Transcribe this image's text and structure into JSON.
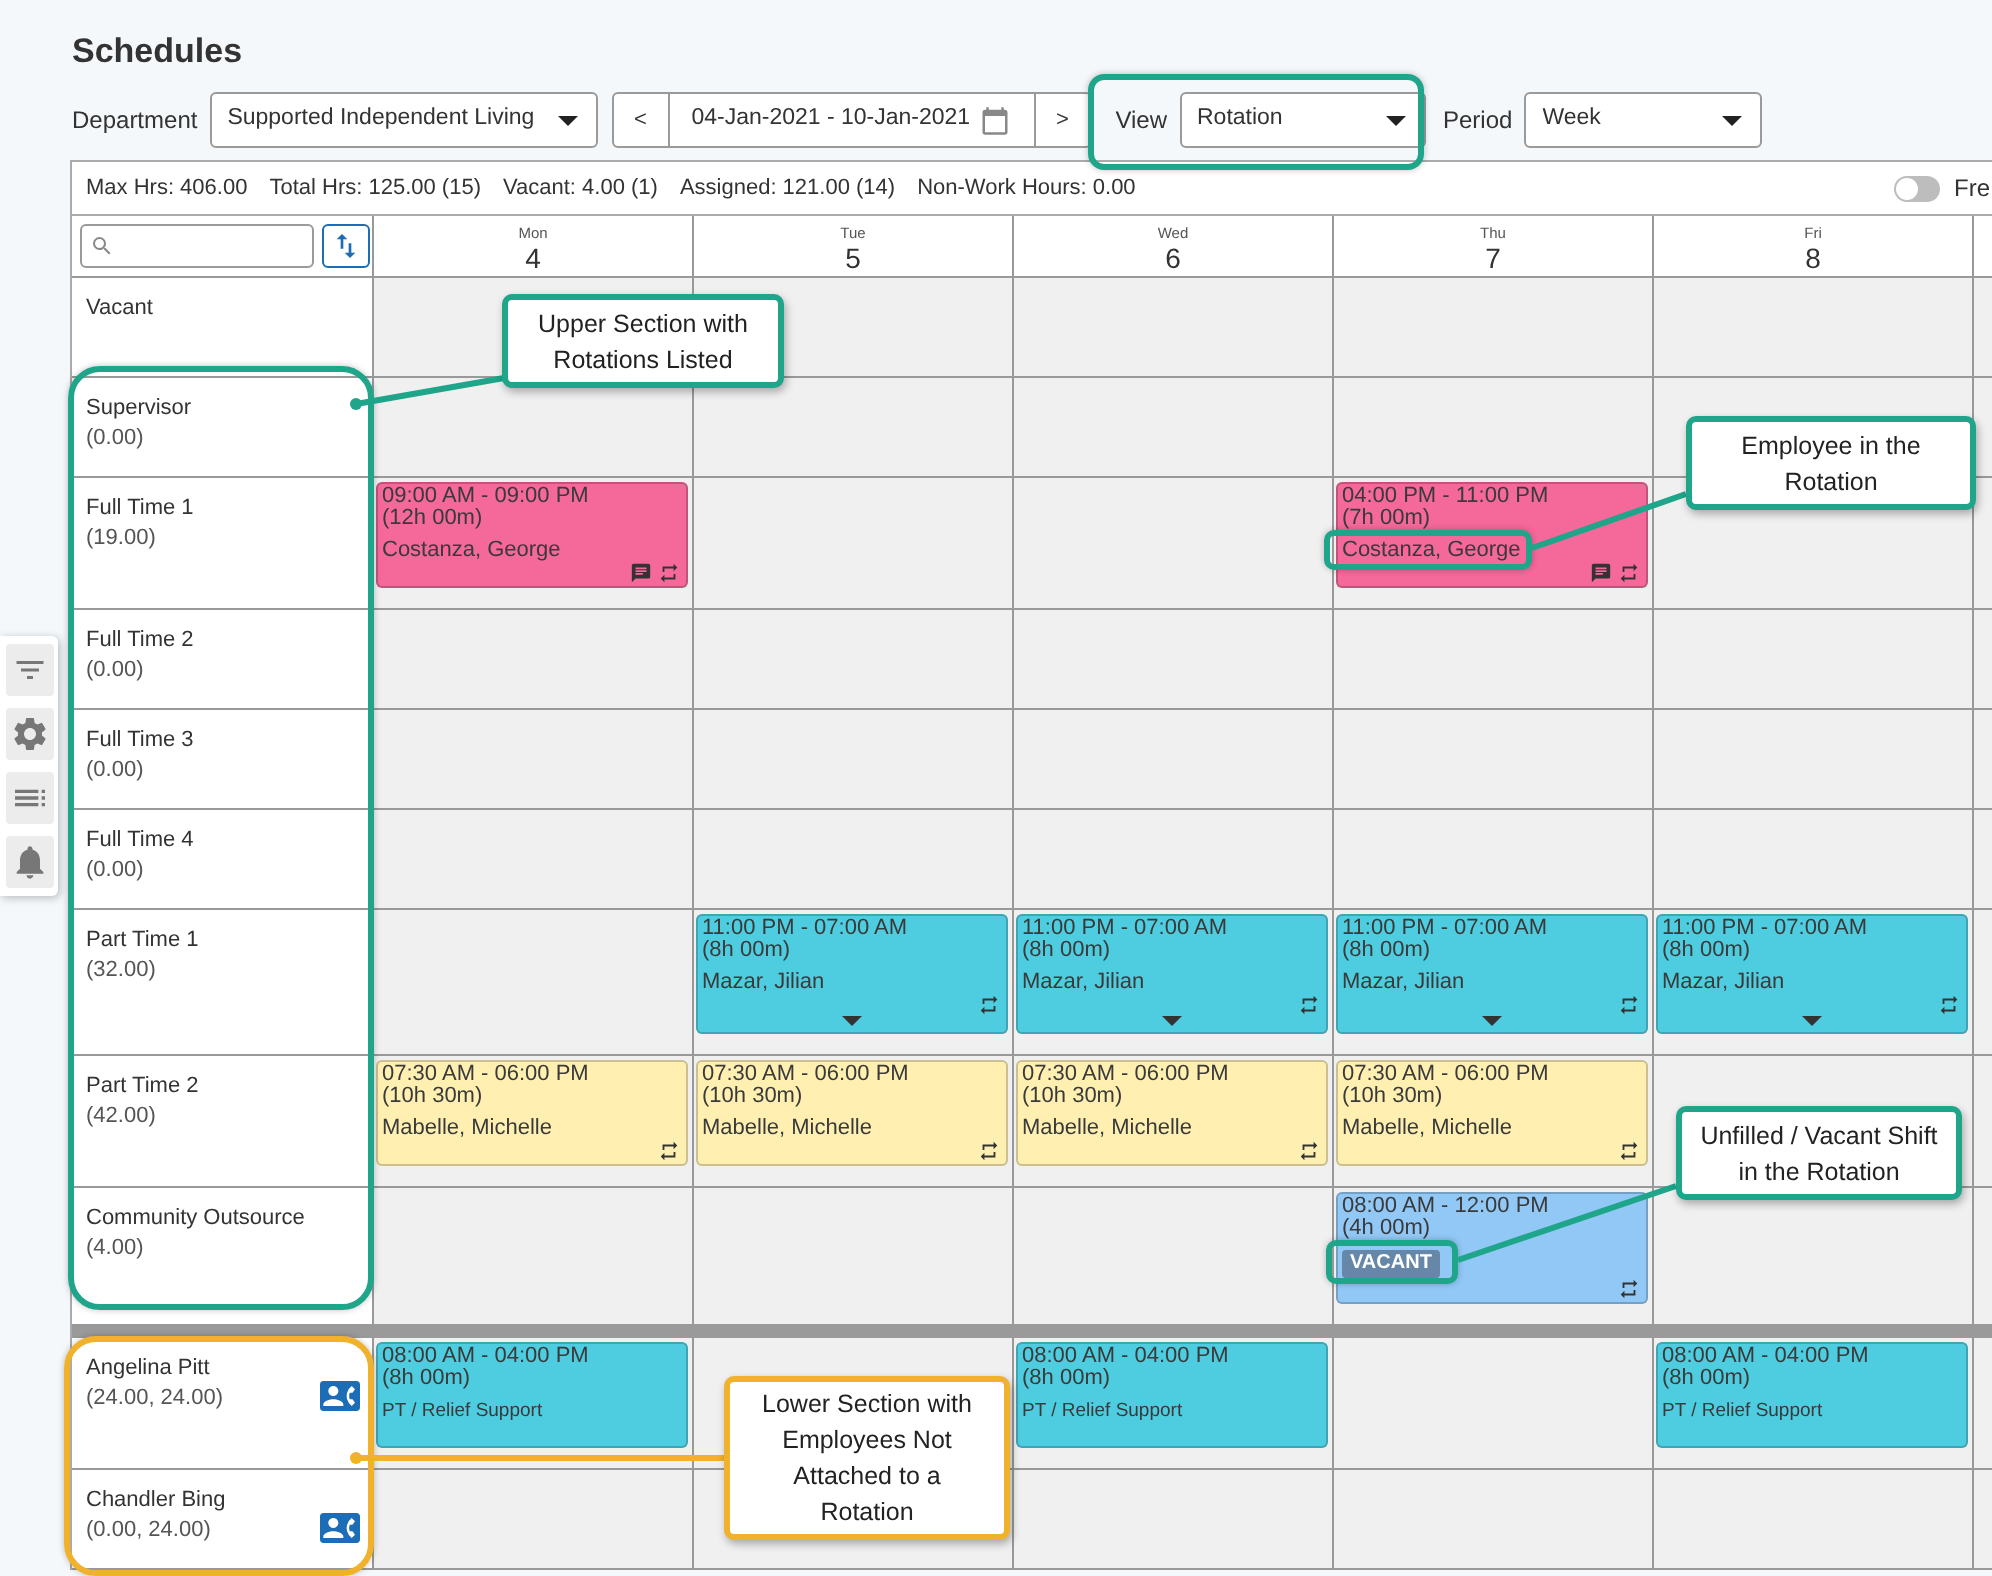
{
  "page": {
    "title": "Schedules"
  },
  "toolbar": {
    "department": {
      "label": "Department",
      "value": "Supported Independent Living"
    },
    "date_range": {
      "previous": "<",
      "value": "04-Jan-2021 - 10-Jan-2021",
      "next": ">"
    },
    "view": {
      "label": "View",
      "value": "Rotation"
    },
    "period": {
      "label": "Period",
      "value": "Week"
    }
  },
  "stats": [
    "Max Hrs: 406.00",
    "Total Hrs: 125.00 (15)",
    "Vacant: 4.00 (1)",
    "Assigned: 121.00 (14)",
    "Non-Work Hours: 0.00"
  ],
  "toggle": {
    "label": "Fre",
    "on": false
  },
  "days": [
    {
      "weekday": "Mon",
      "date": "4"
    },
    {
      "weekday": "Tue",
      "date": "5"
    },
    {
      "weekday": "Wed",
      "date": "6"
    },
    {
      "weekday": "Thu",
      "date": "7"
    },
    {
      "weekday": "Fri",
      "date": "8"
    }
  ],
  "rotations": [
    {
      "name": "Vacant"
    },
    {
      "name": "Supervisor",
      "hours": "(0.00)"
    },
    {
      "name": "Full Time 1",
      "hours": "(19.00)",
      "cells": [
        {
          "time": "09:00 AM - 09:00 PM",
          "duration": "(12h 00m)",
          "employee": "Costanza, George",
          "color": "#f4689a",
          "comment": true,
          "repeat": true,
          "expand": false
        },
        null,
        null,
        {
          "time": "04:00 PM - 11:00 PM",
          "duration": "(7h 00m)",
          "employee": "Costanza, George",
          "color": "#f4689a",
          "comment": true,
          "repeat": true,
          "expand": false
        },
        null
      ]
    },
    {
      "name": "Full Time 2",
      "hours": "(0.00)"
    },
    {
      "name": "Full Time 3",
      "hours": "(0.00)"
    },
    {
      "name": "Full Time 4",
      "hours": "(0.00)"
    },
    {
      "name": "Part Time 1",
      "hours": "(32.00)",
      "cells": [
        null,
        {
          "time": "11:00 PM - 07:00 AM",
          "duration": "(8h 00m)",
          "employee": "Mazar, Jilian",
          "color": "#4fcde0",
          "comment": false,
          "repeat": true,
          "expand": true
        },
        {
          "time": "11:00 PM - 07:00 AM",
          "duration": "(8h 00m)",
          "employee": "Mazar, Jilian",
          "color": "#4fcde0",
          "comment": false,
          "repeat": true,
          "expand": true
        },
        {
          "time": "11:00 PM - 07:00 AM",
          "duration": "(8h 00m)",
          "employee": "Mazar, Jilian",
          "color": "#4fcde0",
          "comment": false,
          "repeat": true,
          "expand": true
        },
        {
          "time": "11:00 PM - 07:00 AM",
          "duration": "(8h 00m)",
          "employee": "Mazar, Jilian",
          "color": "#4fcde0",
          "comment": false,
          "repeat": true,
          "expand": true
        }
      ]
    },
    {
      "name": "Part Time 2",
      "hours": "(42.00)",
      "cells": [
        {
          "time": "07:30 AM - 06:00 PM",
          "duration": "(10h 30m)",
          "employee": "Mabelle, Michelle",
          "color": "#fff0b2",
          "comment": false,
          "repeat": true,
          "expand": false
        },
        {
          "time": "07:30 AM - 06:00 PM",
          "duration": "(10h 30m)",
          "employee": "Mabelle, Michelle",
          "color": "#fff0b2",
          "comment": false,
          "repeat": true,
          "expand": false
        },
        {
          "time": "07:30 AM - 06:00 PM",
          "duration": "(10h 30m)",
          "employee": "Mabelle, Michelle",
          "color": "#fff0b2",
          "comment": false,
          "repeat": true,
          "expand": false
        },
        {
          "time": "07:30 AM - 06:00 PM",
          "duration": "(10h 30m)",
          "employee": "Mabelle, Michelle",
          "color": "#fff0b2",
          "comment": false,
          "repeat": true,
          "expand": false
        },
        null
      ]
    },
    {
      "name": "Community Outsource",
      "hours": "(4.00)",
      "cells": [
        null,
        null,
        null,
        {
          "time": "08:00 AM - 12:00 PM",
          "duration": "(4h 00m)",
          "badge": "VACANT",
          "color": "#92c8f6",
          "comment": false,
          "repeat": true,
          "expand": false
        },
        null
      ]
    }
  ],
  "employees": [
    {
      "name": "Angelina Pitt",
      "hours": "(24.00, 24.00)",
      "cells": [
        {
          "time": "08:00 AM - 04:00 PM",
          "duration": "(8h 00m)",
          "role": "PT / Relief Support",
          "color": "#4fcde0",
          "comment": false,
          "repeat": false,
          "expand": false
        },
        null,
        {
          "time": "08:00 AM - 04:00 PM",
          "duration": "(8h 00m)",
          "role": "PT / Relief Support",
          "color": "#4fcde0",
          "comment": false,
          "repeat": false,
          "expand": false
        },
        null,
        {
          "time": "08:00 AM - 04:00 PM",
          "duration": "(8h 00m)",
          "role": "PT / Relief Support",
          "color": "#4fcde0",
          "comment": false,
          "repeat": false,
          "expand": false
        }
      ]
    },
    {
      "name": "Chandler Bing",
      "hours": "(0.00, 24.00)"
    }
  ],
  "annotations": [
    {
      "kind": "frame",
      "color": "#1fa58a"
    },
    {
      "kind": "callout",
      "text": "Upper Section with Rotations Listed",
      "color": "#1fa58a"
    },
    {
      "kind": "callout",
      "text": "Employee in the Rotation",
      "color": "#1fa58a"
    },
    {
      "kind": "callout",
      "text": "Unfilled / Vacant Shift in the Rotation",
      "color": "#1fa58a"
    },
    {
      "kind": "callout",
      "text": "Lower Section with Employees Not Attached to a Rotation",
      "color": "#f0b22c"
    }
  ]
}
